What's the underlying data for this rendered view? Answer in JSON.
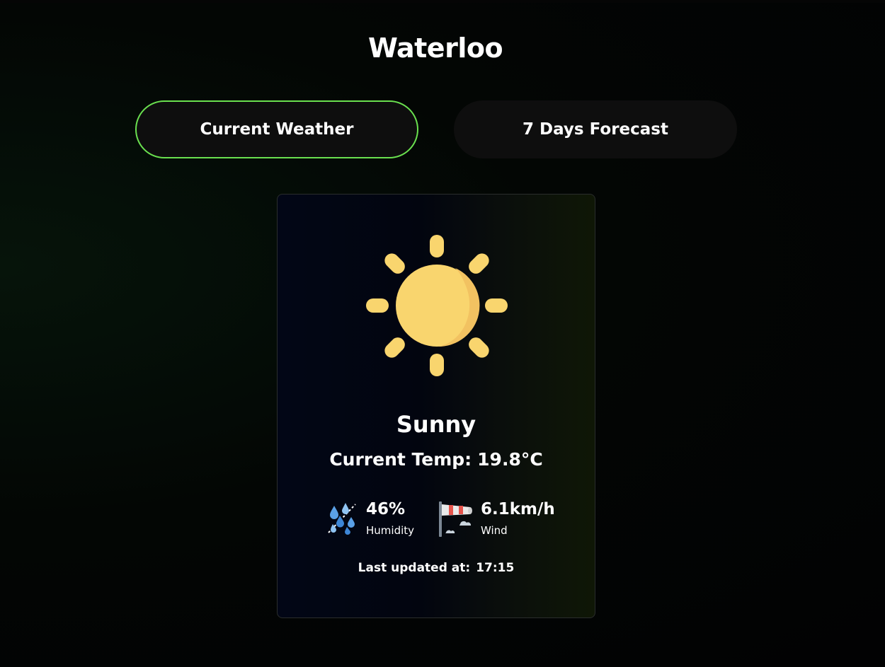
{
  "city": "Waterloo",
  "tabs": {
    "current_label": "Current Weather",
    "forecast_label": "7 Days Forecast",
    "active": "Current Weather"
  },
  "weather": {
    "condition": "Sunny",
    "condition_icon": "sun-icon",
    "temp_label": "Current Temp:",
    "temp_value": "19.8°C",
    "humidity": {
      "value": "46%",
      "label": "Humidity",
      "icon": "humidity-icon"
    },
    "wind": {
      "value": "6.1km/h",
      "label": "Wind",
      "icon": "windsock-icon"
    },
    "updated_label": "Last updated at:",
    "updated_time": "17:15"
  },
  "colors": {
    "active_tab_border": "#6ae04f",
    "tab_background": "#0e0e0e",
    "sun": "#f9d56e",
    "sun_shade": "#f2c261"
  }
}
